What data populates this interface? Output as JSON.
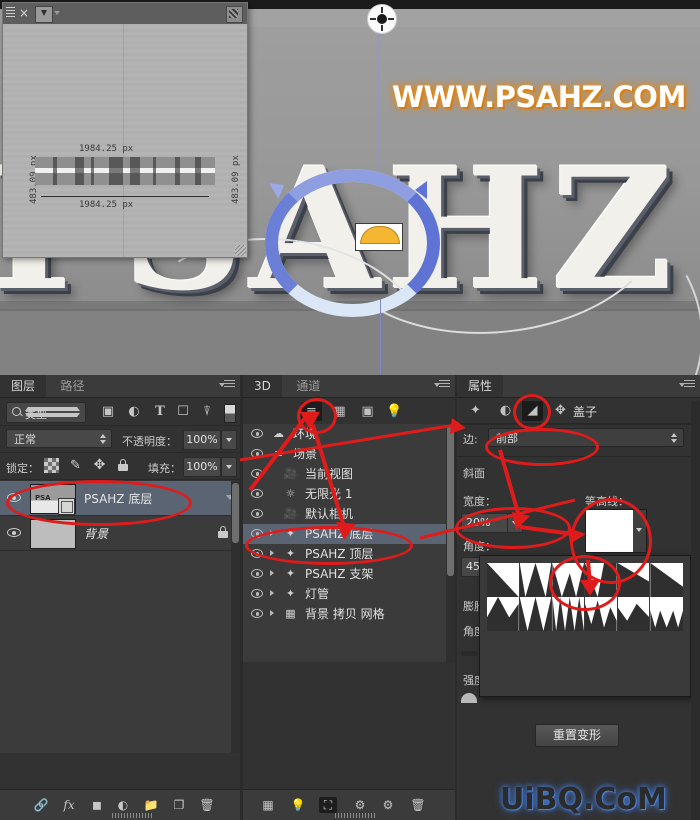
{
  "app": {
    "name": "Adobe Photoshop CC 3D workspace"
  },
  "watermarks": {
    "top": "WWW.PSAHZ.COM",
    "bottom": "UiBQ.CoM"
  },
  "canvas": {
    "letters": "PSAHZ",
    "ground_widget": "3d-ground-plane-widget"
  },
  "info_window": {
    "close_label": "×",
    "width_top": "1984.25 px",
    "width_bottom": "1984.25 px",
    "height_left": "483.09 px",
    "height_right": "483.09 px"
  },
  "layers_panel": {
    "tabs": [
      {
        "label": "图层",
        "active": true
      },
      {
        "label": "路径",
        "active": false
      }
    ],
    "filter": {
      "value": "类型",
      "icons": [
        "image-filter-icon",
        "adjustment-filter-icon",
        "type-filter-icon",
        "shape-filter-icon",
        "smartobject-filter-icon",
        "filter-toggle-icon"
      ]
    },
    "blend_mode": "正常",
    "opacity_label": "不透明度：",
    "opacity_value": "100%",
    "lock_label": "锁定：",
    "lock_icons": [
      "lock-transparency-icon",
      "lock-pixels-icon",
      "lock-position-icon",
      "lock-all-icon"
    ],
    "fill_label": "填充：",
    "fill_value": "100%",
    "layers": [
      {
        "name": "PSAHZ 底层",
        "thumb_text": "PSA",
        "selected": true,
        "locked": false,
        "is3d": true
      },
      {
        "name": "背景",
        "thumb_text": "",
        "selected": false,
        "locked": true,
        "is3d": false
      }
    ],
    "bottom_icons": [
      "link-layers-icon",
      "add-layer-style-icon",
      "add-layer-mask-icon",
      "new-adjustment-layer-icon",
      "new-group-icon",
      "new-layer-icon",
      "delete-layer-icon"
    ],
    "fx_label": "fx"
  },
  "panel_3d": {
    "tabs": [
      {
        "label": "3D",
        "active": true
      },
      {
        "label": "通道",
        "active": false
      }
    ],
    "filter_icons": [
      "scene-filter-icon",
      "mesh-filter-icon",
      "material-filter-icon",
      "light-filter-icon"
    ],
    "active_filter_index": 0,
    "items": [
      {
        "label": "环境",
        "icon": "environment-icon",
        "indent": 0,
        "twisty": false,
        "selected": false
      },
      {
        "label": "场景",
        "icon": "scene-icon",
        "indent": 0,
        "twisty": false,
        "selected": false
      },
      {
        "label": "当前视图",
        "icon": "camera-icon",
        "indent": 1,
        "twisty": false,
        "selected": false
      },
      {
        "label": "无限光 1",
        "icon": "light-icon",
        "indent": 1,
        "twisty": false,
        "selected": false
      },
      {
        "label": "默认相机",
        "icon": "camera-icon",
        "indent": 1,
        "twisty": false,
        "selected": false
      },
      {
        "label": "PSAHZ 底层",
        "icon": "mesh-icon",
        "indent": 1,
        "twisty": true,
        "selected": true
      },
      {
        "label": "PSAHZ 顶层",
        "icon": "mesh-icon",
        "indent": 1,
        "twisty": true,
        "selected": false
      },
      {
        "label": "PSAHZ 支架",
        "icon": "mesh-icon",
        "indent": 1,
        "twisty": true,
        "selected": false
      },
      {
        "label": "灯管",
        "icon": "mesh-icon",
        "indent": 1,
        "twisty": true,
        "selected": false
      },
      {
        "label": "背景 拷贝 网格",
        "icon": "grid-mesh-icon",
        "indent": 1,
        "twisty": true,
        "selected": false
      }
    ],
    "bottom_icons": [
      "add-mesh-icon",
      "add-light-icon",
      "render-icon",
      "add-point-light-icon",
      "delete-3d-icon",
      "trash-icon"
    ]
  },
  "properties_panel": {
    "tab": "属性",
    "icons": [
      "mesh-prop-icon",
      "deform-prop-icon",
      "cap-prop-icon",
      "coordinates-prop-icon"
    ],
    "active_icon_index": 2,
    "title": "盖子",
    "side_label": "边:",
    "side_value": "前部",
    "bevel_label": "斜面",
    "width_label": "宽度：",
    "width_value": "20%",
    "angle_label": "角度：",
    "angle_value": "45°",
    "contour_label": "等高线：",
    "inflate_label": "膨胀",
    "inflate_angle_label": "角度",
    "strength_label": "强度",
    "reset_button": "重置变形"
  },
  "annotations": {
    "color": "#e01b1b",
    "marks": [
      "ellipse-around-layer-psahz-bottom",
      "ellipse-around-3d-scene-filter-icon",
      "ellipse-around-3d-item-psahz-bottom",
      "ellipse-around-cap-prop-icon",
      "ellipse-around-side-value",
      "ellipse-around-width-value",
      "ellipse-around-contour-swatch",
      "ellipse-around-contour-popup-item"
    ]
  }
}
